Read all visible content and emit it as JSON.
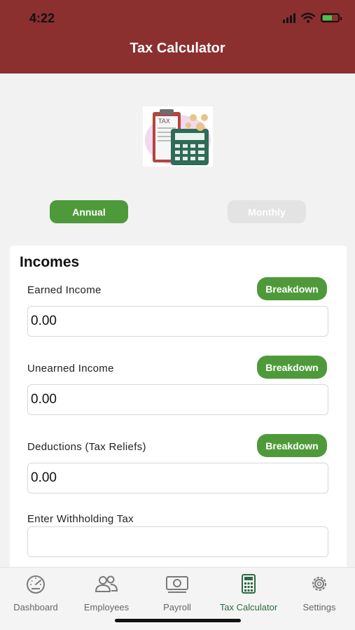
{
  "status_bar": {
    "time": "4:22"
  },
  "header": {
    "title": "Tax Calculator"
  },
  "logo": {
    "text": "TAX"
  },
  "period_toggle": {
    "annual": "Annual",
    "monthly": "Monthly"
  },
  "incomes": {
    "title": "Incomes",
    "earned": {
      "label": "Earned Income",
      "value": "0.00",
      "button": "Breakdown"
    },
    "unearned": {
      "label": "Unearned Income",
      "value": "0.00",
      "button": "Breakdown"
    },
    "deductions": {
      "label": "Deductions (Tax Reliefs)",
      "value": "0.00",
      "button": "Breakdown"
    },
    "withholding": {
      "label": "Enter Withholding Tax",
      "value": ""
    }
  },
  "tabs": [
    {
      "label": "Dashboard",
      "icon": "speedometer-icon"
    },
    {
      "label": "Employees",
      "icon": "people-icon"
    },
    {
      "label": "Payroll",
      "icon": "money-icon"
    },
    {
      "label": "Tax Calculator",
      "icon": "calculator-icon",
      "active": true
    },
    {
      "label": "Settings",
      "icon": "gear-icon"
    }
  ],
  "colors": {
    "header": "#8b2f2f",
    "accent_green": "#4e9a3a",
    "active_tab": "#2d6a43"
  }
}
